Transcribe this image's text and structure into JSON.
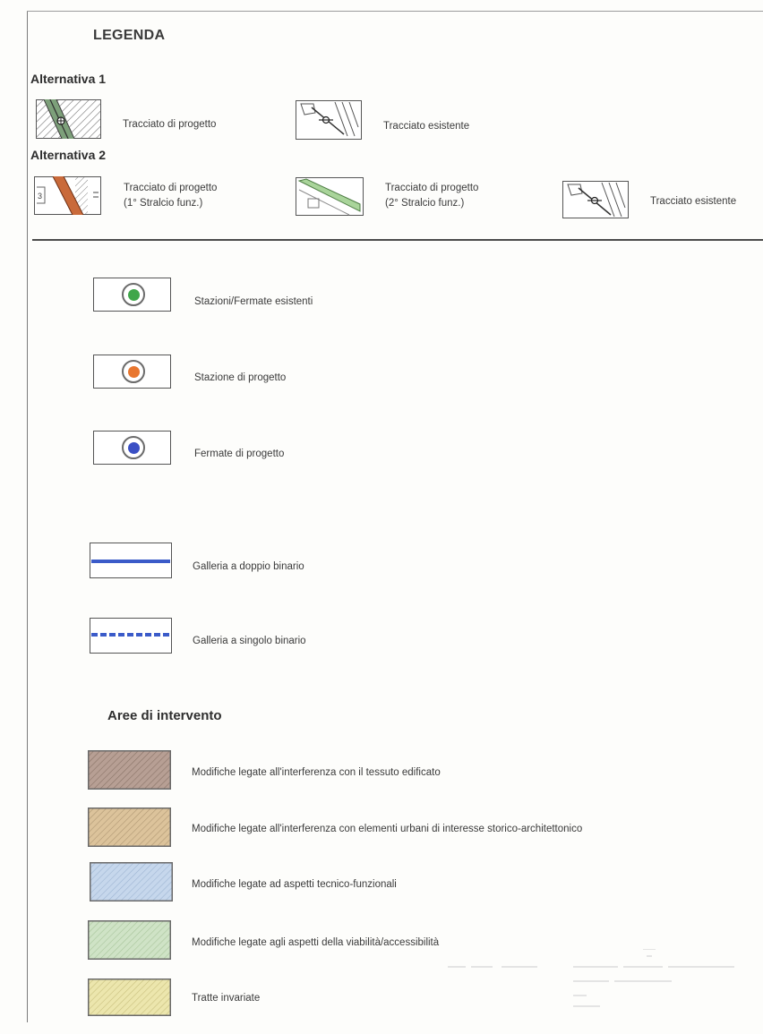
{
  "legend_title": "LEGENDA",
  "alternativa1": {
    "heading": "Alternativa 1",
    "items": [
      {
        "label": "Tracciato di progetto",
        "icon": "hatched-track-green-icon"
      },
      {
        "label": "Tracciato esistente",
        "icon": "existing-track-icon"
      }
    ]
  },
  "alternativa2": {
    "heading": "Alternativa 2",
    "items": [
      {
        "label_line1": "Tracciato di progetto",
        "label_line2": "(1° Stralcio funz.)",
        "icon": "track-orange-icon"
      },
      {
        "label_line1": "Tracciato di progetto",
        "label_line2": "(2° Stralcio funz.)",
        "icon": "track-green-icon"
      },
      {
        "label_line1": "Tracciato esistente",
        "label_line2": "",
        "icon": "existing-track-icon"
      }
    ]
  },
  "stations": [
    {
      "label": "Stazioni/Fermate esistenti",
      "color": "#3fa64a"
    },
    {
      "label": "Stazione di progetto",
      "color": "#e8762f"
    },
    {
      "label": "Fermate di progetto",
      "color": "#3a4fc4"
    }
  ],
  "tunnels": [
    {
      "label": "Galleria a doppio binario",
      "style": "solid",
      "color": "#3b5bc9"
    },
    {
      "label": "Galleria a singolo binario",
      "style": "dashed",
      "color": "#3b5bc9"
    }
  ],
  "areas": {
    "heading": "Aree di intervento",
    "items": [
      {
        "label": "Modifiche legate all'interferenza con il tessuto edificato",
        "color": "#b79f94",
        "hatch": "#8a7468"
      },
      {
        "label": "Modifiche legate all'interferenza con elementi urbani di interesse storico-architettonico",
        "color": "#dcc39b",
        "hatch": "#b09874"
      },
      {
        "label": "Modifiche legate ad aspetti tecnico-funzionali",
        "color": "#c6d7ec",
        "hatch": "#9fb6d3"
      },
      {
        "label": "Modifiche legate agli aspetti della viabilità/accessibilità",
        "color": "#cfe3c6",
        "hatch": "#a9c59c"
      },
      {
        "label": "Tratte invariate",
        "color": "#ece6ad",
        "hatch": "#c9c17f"
      }
    ]
  }
}
